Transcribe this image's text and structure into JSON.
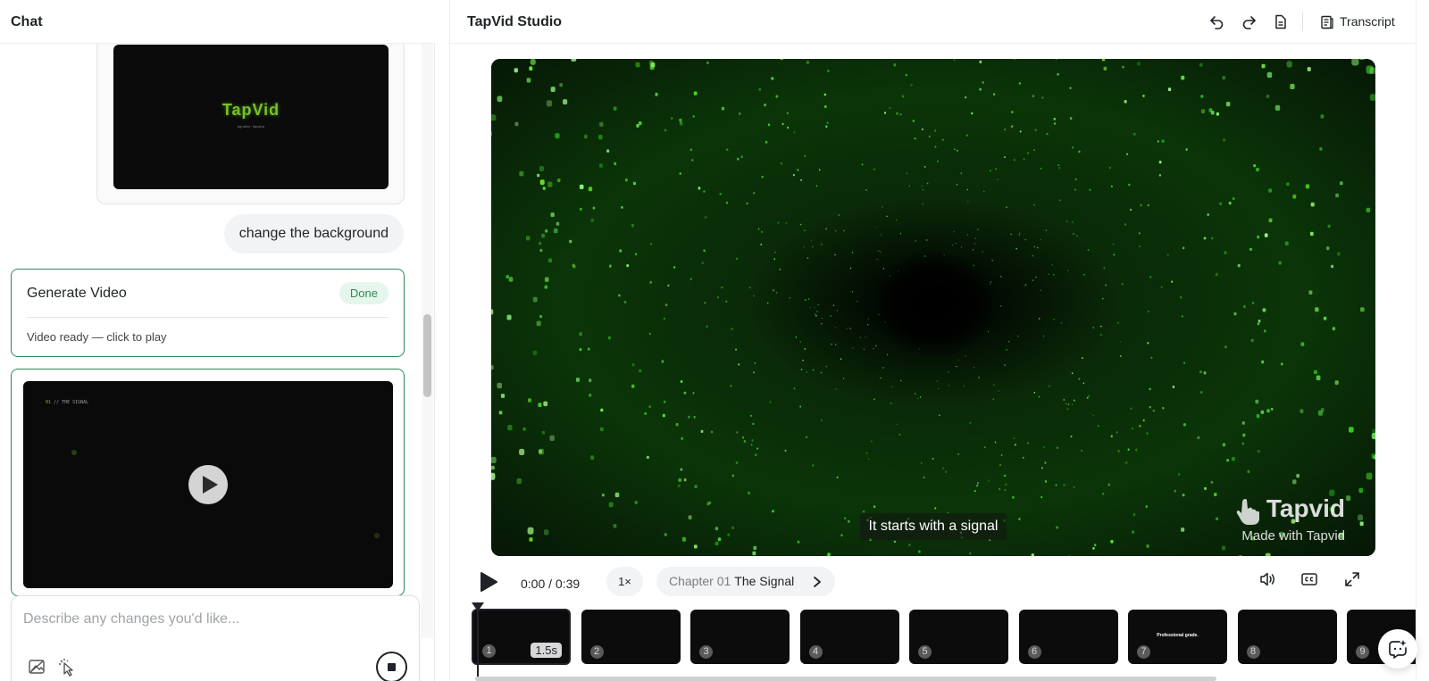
{
  "chat": {
    "title": "Chat",
    "preview": {
      "logo": "TapVid",
      "subtitle": "tap video · tapvid.ai"
    },
    "user_message": "change the background",
    "generate_card": {
      "title": "Generate Video",
      "badge": "Done",
      "status": "Video ready — click to play"
    },
    "video_card": {
      "caption_num": "01",
      "caption_text": "// THE SIGNAL"
    },
    "composer": {
      "placeholder": "Describe any changes you'd like..."
    }
  },
  "studio": {
    "title": "TapVid Studio",
    "transcript_label": "Transcript",
    "player": {
      "subtitle": "It starts with a signal",
      "watermark_logo": "Tapvid",
      "watermark_sub": "Made with Tapvid"
    },
    "controls": {
      "time": "0:00 / 0:39",
      "speed": "1×",
      "chapter_num": "Chapter 01",
      "chapter_name": "The Signal"
    },
    "timeline": {
      "clips": [
        {
          "num": "1",
          "duration": "1.5s"
        },
        {
          "num": "2"
        },
        {
          "num": "3"
        },
        {
          "num": "4"
        },
        {
          "num": "5"
        },
        {
          "num": "6"
        },
        {
          "num": "7",
          "text": "Professional grade."
        },
        {
          "num": "8"
        },
        {
          "num": "9"
        }
      ]
    }
  },
  "icons": {
    "undo": "undo-icon",
    "redo": "redo-icon",
    "document": "document-icon",
    "transcript": "transcript-icon",
    "play": "play-icon",
    "volume": "volume-icon",
    "captions": "cc-icon",
    "fullscreen": "fullscreen-icon",
    "stop": "stop-icon",
    "chevron": "chevron-right-icon"
  },
  "colors": {
    "accent": "#2f8a5a",
    "badge_bg": "#e7f6ec",
    "matrix_green": "#4cd12a"
  }
}
